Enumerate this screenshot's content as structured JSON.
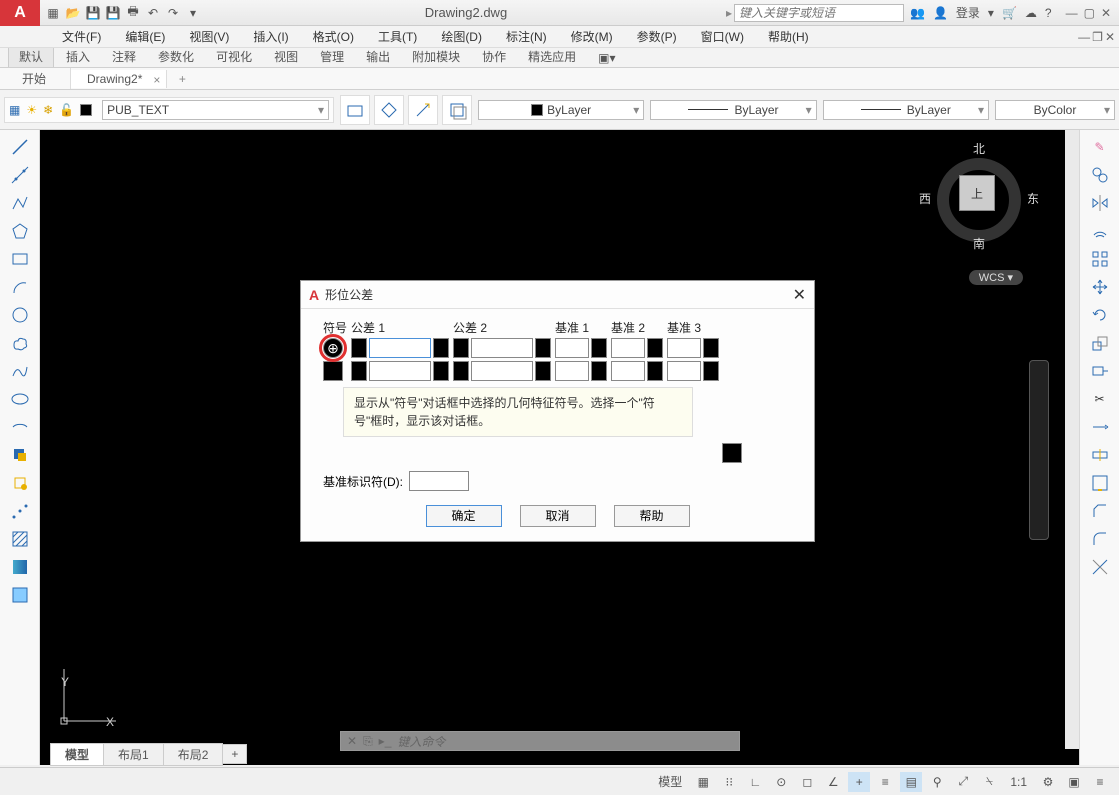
{
  "title": "Drawing2.dwg",
  "search_placeholder": "键入关键字或短语",
  "login_label": "登录",
  "menus": [
    "文件(F)",
    "编辑(E)",
    "视图(V)",
    "插入(I)",
    "格式(O)",
    "工具(T)",
    "绘图(D)",
    "标注(N)",
    "修改(M)",
    "参数(P)",
    "窗口(W)",
    "帮助(H)"
  ],
  "ribbon_tabs": [
    "默认",
    "插入",
    "注释",
    "参数化",
    "可视化",
    "视图",
    "管理",
    "输出",
    "附加模块",
    "协作",
    "精选应用"
  ],
  "doc_tabs": [
    {
      "label": "开始",
      "active": false
    },
    {
      "label": "Drawing2*",
      "active": true
    }
  ],
  "layer_name": "PUB_TEXT",
  "prop_dropdowns": [
    "ByLayer",
    "ByLayer",
    "ByLayer",
    "ByColor"
  ],
  "viewcube": {
    "n": "北",
    "s": "南",
    "e": "东",
    "w": "西",
    "top": "上",
    "wcs": "WCS ▾"
  },
  "ucs": {
    "x": "X",
    "y": "Y"
  },
  "cmd_placeholder": "键入命令",
  "layout_tabs": [
    "模型",
    "布局1",
    "布局2"
  ],
  "status": {
    "model": "模型",
    "scale": "1:1"
  },
  "dialog": {
    "title": "形位公差",
    "headers": {
      "sym": "符号",
      "tol1": "公差 1",
      "tol2": "公差 2",
      "d1": "基准 1",
      "d2": "基准 2",
      "d3": "基准 3"
    },
    "tooltip": "显示从\"符号\"对话框中选择的几何特征符号。选择一个\"符号\"框时，显示该对话框。",
    "datum_id_label": "基准标识符(D):",
    "buttons": {
      "ok": "确定",
      "cancel": "取消",
      "help": "帮助"
    }
  }
}
